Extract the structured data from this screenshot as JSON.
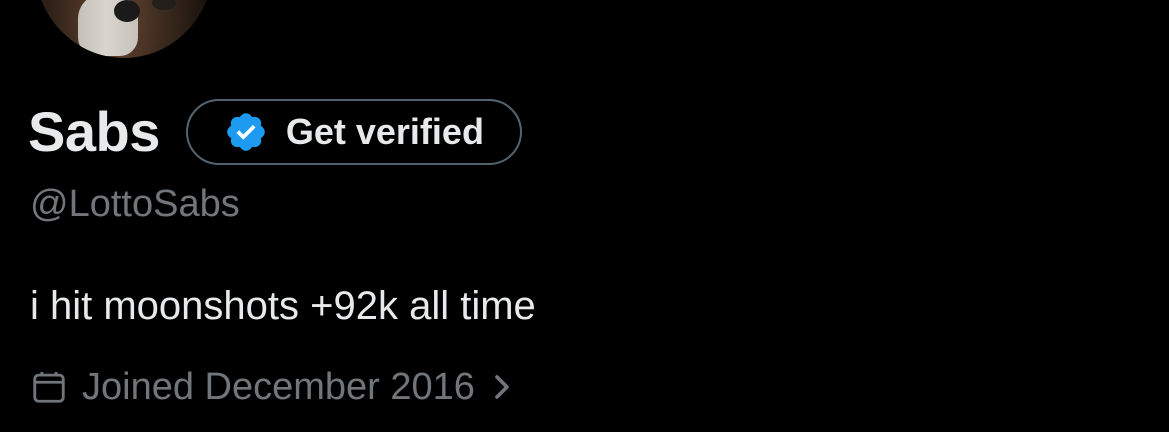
{
  "profile": {
    "display_name": "Sabs",
    "handle": "@LottoSabs",
    "bio": "i hit moonshots +92k all time",
    "joined": "Joined December 2016"
  },
  "verify_button": {
    "label": "Get verified",
    "icon": "verified-badge-icon"
  },
  "icons": {
    "calendar": "calendar-icon",
    "chevron": "chevron-right-icon"
  },
  "colors": {
    "background": "#000000",
    "primary_text": "#e7e9ea",
    "secondary_text": "#71767b",
    "badge_blue": "#1d9bf0",
    "button_border": "#536471"
  }
}
